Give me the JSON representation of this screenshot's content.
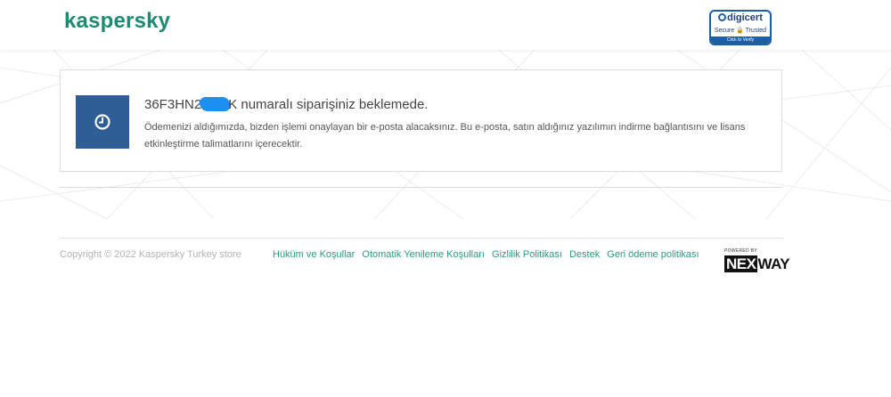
{
  "header": {
    "logo_text": "kaspersky",
    "badge": {
      "brand": "digicert",
      "line": "Secure 🔒 Trusted",
      "cta": "Click to Verify"
    }
  },
  "order": {
    "title_prefix": "36F3HN2",
    "title_suffix": "K numaralı siparişiniz beklemede.",
    "description": "Ödemenizi aldığımızda, bizden işlemi onaylayan bir e-posta alacaksınız. Bu e-posta, satın aldığınız yazılımın indirme bağlantısını ve lisans etkinleştirme talimatlarını içerecektir.",
    "status_icon": "clock-icon"
  },
  "footer": {
    "copyright": "Copyright © 2022 Kaspersky Turkey store",
    "links": [
      "Hüküm ve Koşullar",
      "Otomatik Yenileme Koşulları",
      "Gizlilik Politikası",
      "Destek",
      "Geri ödeme politikası"
    ],
    "powered_by": "POWERED BY",
    "nexway_a": "NEX",
    "nexway_b": "WAY"
  },
  "colors": {
    "brand": "#1d8a72",
    "link": "#2a9b82",
    "status_box": "#2f5e96",
    "redaction": "#1e8ef0"
  }
}
